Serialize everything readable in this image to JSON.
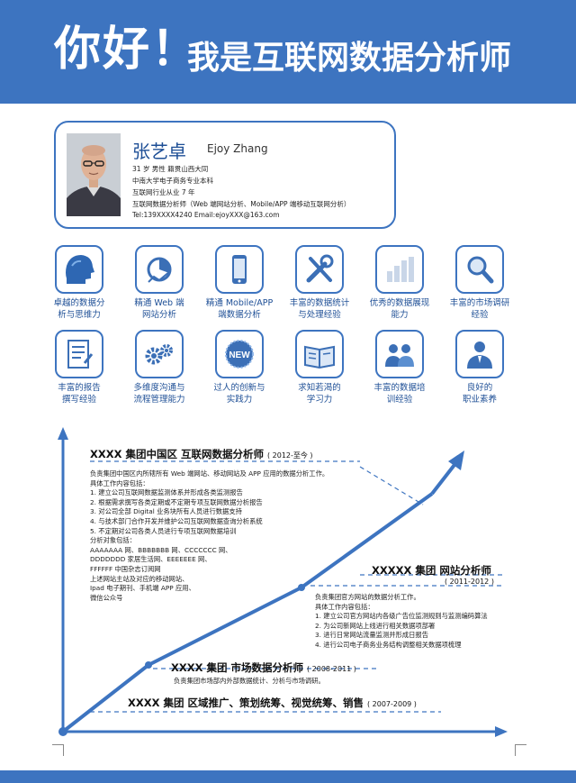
{
  "header": {
    "big": "你好！",
    "rest": "我是互联网数据分析师"
  },
  "profile": {
    "name": "张艺卓",
    "english_name": "Ejoy Zhang",
    "info_lines": [
      "31 岁  男性  籍贯山西大同",
      "中南大学电子商务专业本科",
      "互联网行业从业 7 年",
      "互联网数据分析师（Web 端网站分析、Mobile/APP 端移动互联网分析）",
      "Tel:139XXXX4240    Email:ejoyXXX@163.com"
    ]
  },
  "skills_row1": [
    {
      "icon": "head-profile-icon",
      "label": [
        "卓越的数据分",
        "析与思维力"
      ]
    },
    {
      "icon": "web-analytics-icon",
      "label": [
        "精通 Web 端",
        "网站分析"
      ]
    },
    {
      "icon": "mobile-phone-icon",
      "label": [
        "精通 Mobile/APP",
        "端数据分析"
      ]
    },
    {
      "icon": "tools-icon",
      "label": [
        "丰富的数据统计",
        "与处理经验"
      ]
    },
    {
      "icon": "bar-chart-icon",
      "label": [
        "优秀的数据展现",
        "能力"
      ]
    },
    {
      "icon": "magnifier-icon",
      "label": [
        "丰富的市场调研",
        "经验"
      ]
    }
  ],
  "skills_row2": [
    {
      "icon": "report-document-icon",
      "label": [
        "丰富的报告",
        "撰写经验"
      ]
    },
    {
      "icon": "gears-icon",
      "label": [
        "多维度沟通与",
        "流程管理能力"
      ]
    },
    {
      "icon": "new-badge-icon",
      "label": [
        "过人的创新与",
        "实践力"
      ]
    },
    {
      "icon": "open-book-icon",
      "label": [
        "求知若渴的",
        "学习力"
      ]
    },
    {
      "icon": "group-people-icon",
      "label": [
        "丰富的数据培",
        "训经验"
      ]
    },
    {
      "icon": "business-person-icon",
      "label": [
        "良好的",
        "职业素养"
      ]
    }
  ],
  "jobs": [
    {
      "title": "XXXX 集团中国区  互联网数据分析师",
      "years": "( 2012-至今 )",
      "lines": [
        "负责集团中国区内所辖所有 Web 端网站、移动网站及 APP 应用的数据分析工作。",
        "具体工作内容包括：",
        "1.  建立公司互联网数据监测体系并形成各类监测报告",
        "2.  根据需求撰写各类定期或不定期专项互联网数据分析报告",
        "3.  对公司全部 Digital 业务块所有人员进行数据支持",
        "4.  与技术部门合作开发并维护公司互联网数据查询分析系统",
        "5.  不定期对公司各类人员进行专项互联网数据培训",
        "分析对象包括：",
        "AAAAAAA 网、BBBBBBB 网、CCCCCCC 网、",
        "DDDDDDD 家居生活网、EEEEEEE 网、",
        "FFFFFF 中国杂志订阅网",
        "上述网站主站及对应的移动网站、",
        "Ipad 电子期刊、手机端 APP 应用、",
        "微信公众号"
      ]
    },
    {
      "title": "XXXXX 集团  网站分析师",
      "years": "( 2011-2012 )",
      "lines": [
        "负责集团官方网站的数据分析工作。",
        "具体工作内容包括：",
        "1.  建立公司官方网站内各级广告位监测规则与监测编码算法",
        "2.  为公司新网站上线进行相关数据项部署",
        "3.  进行日常网站流量监测并形成日报告",
        "4.  进行公司电子商务业务结构调整相关数据项梳理"
      ]
    },
    {
      "title": "XXXX 集团  市场数据分析师",
      "years": "( 2008-2011 )",
      "lines": [
        "负责集团市场部内外部数据统计、分析与市场调研。"
      ]
    },
    {
      "title": "XXXX 集团  区域推广、策划统筹、视觉统筹、销售",
      "years": "( 2007-2009 )",
      "lines": []
    }
  ],
  "colors": {
    "primary": "#3d74c0",
    "primary_dark": "#1e4f96",
    "icon_fill": "#3b6fb6"
  }
}
